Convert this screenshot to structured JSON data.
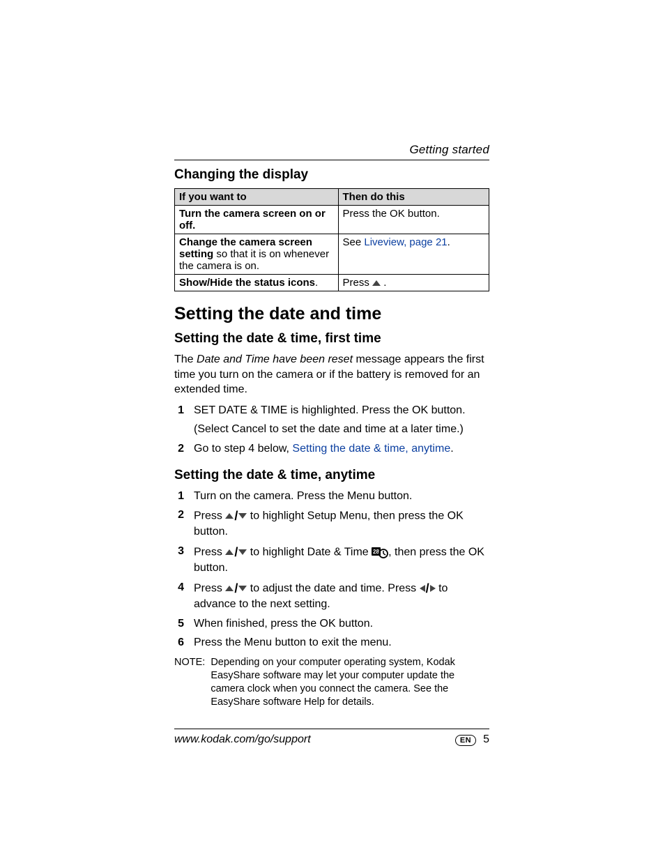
{
  "running_head": "Getting started",
  "section1_title": "Changing the display",
  "table": {
    "header": {
      "c1": "If you want to",
      "c2": "Then do this"
    },
    "rows": [
      {
        "c1_bold": "Turn the camera screen on or off.",
        "c2": "Press the OK button."
      },
      {
        "c1_bold": "Change the camera screen setting",
        "c1_rest": " so that it is on whenever the camera is on.",
        "c2_pre": "See ",
        "c2_link": "Liveview, page 21",
        "c2_post": "."
      },
      {
        "c1_bold": "Show/Hide the status icons",
        "c1_rest": ".",
        "c2_pre": "Press ",
        "c2_icon": "up",
        "c2_post": " ."
      }
    ]
  },
  "h2": "Setting the date and time",
  "sub1_title": "Setting the date & time, first time",
  "sub1_para_pre": "The ",
  "sub1_para_italic": "Date and Time have been reset",
  "sub1_para_post": " message appears the first time you turn on the camera or if the battery is removed for an extended time.",
  "sub1_steps": [
    {
      "num": "1",
      "text": "SET DATE & TIME is highlighted. Press the OK button.",
      "sub": "(Select Cancel to set the date and time at a later time.)"
    },
    {
      "num": "2",
      "text_pre": "Go to step 4 below, ",
      "text_link": "Setting the date & time, anytime",
      "text_post": "."
    }
  ],
  "sub2_title": "Setting the date & time, anytime",
  "sub2_steps": {
    "s1": {
      "num": "1",
      "text": "Turn on the camera. Press the Menu button."
    },
    "s2": {
      "num": "2",
      "pre": "Press ",
      "post": " to highlight Setup Menu, then press the OK button."
    },
    "s3": {
      "num": "3",
      "pre": "Press ",
      "mid": " to highlight Date & Time ",
      "post": ", then press the OK button."
    },
    "s4": {
      "num": "4",
      "pre": "Press ",
      "mid": " to adjust the date and time. Press ",
      "post": " to advance to the next setting."
    },
    "s5": {
      "num": "5",
      "text": "When finished, press the OK button."
    },
    "s6": {
      "num": "6",
      "text": "Press the Menu button to exit the menu."
    }
  },
  "note_label": "NOTE:",
  "note_text": "Depending on your computer operating system, Kodak EasyShare software may let your computer update the camera clock when you connect the camera. See the EasyShare software Help for details.",
  "footer_url": "www.kodak.com/go/support",
  "footer_lang": "EN",
  "footer_page": "5"
}
